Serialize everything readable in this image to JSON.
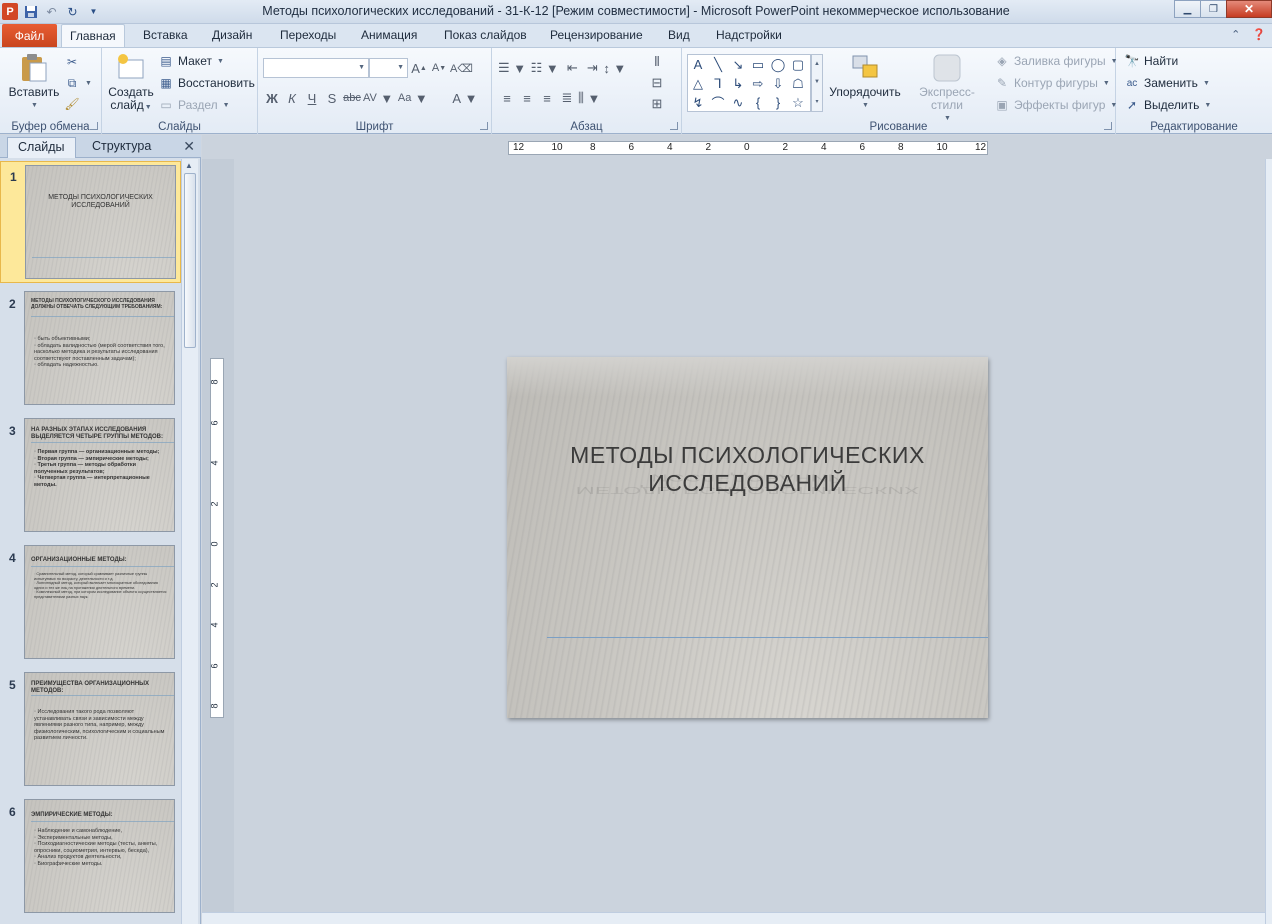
{
  "window": {
    "title": "Методы психологических исследований - 31-К-12 [Режим совместимости]  -  Microsoft PowerPoint некоммерческое использование"
  },
  "ribbon_tabs": {
    "file": "Файл",
    "tabs": [
      "Главная",
      "Вставка",
      "Дизайн",
      "Переходы",
      "Анимация",
      "Показ слайдов",
      "Рецензирование",
      "Вид",
      "Надстройки"
    ]
  },
  "clipboard": {
    "paste": "Вставить",
    "label": "Буфер обмена"
  },
  "slides_group": {
    "new_slide": "Создать",
    "new_slide_2": "слайд",
    "layout": "Макет",
    "reset": "Восстановить",
    "section": "Раздел",
    "label": "Слайды"
  },
  "font_group": {
    "label": "Шрифт"
  },
  "paragraph_group": {
    "label": "Абзац"
  },
  "drawing": {
    "arrange": "Упорядочить",
    "quick_styles": "Экспресс-стили",
    "fill": "Заливка фигуры",
    "outline": "Контур фигуры",
    "effects": "Эффекты фигур",
    "label": "Рисование"
  },
  "editing": {
    "find": "Найти",
    "replace": "Заменить",
    "select": "Выделить",
    "label": "Редактирование"
  },
  "panel": {
    "tab_slides": "Слайды",
    "tab_outline": "Структура"
  },
  "thumbnails": [
    {
      "num": "1",
      "title": "МЕТОДЫ ПСИХОЛОГИЧЕСКИХ ИССЛЕДОВАНИЙ"
    },
    {
      "num": "2",
      "title": "МЕТОДЫ ПСИХОЛОГИЧЕСКОГО ИССЛЕДОВАНИЯ ДОЛЖНЫ ОТВЕЧАТЬ СЛЕДУЮЩИМ ТРЕБОВАНИЯМ:",
      "bullets": [
        "быть объективными;",
        "обладать валидностью (мерой соответствия того, насколько методика и результаты исследования соответствуют поставленным задачам);",
        "обладать надежностью."
      ]
    },
    {
      "num": "3",
      "title": "НА РАЗНЫХ ЭТАПАХ ИССЛЕДОВАНИЯ ВЫДЕЛЯЕТСЯ ЧЕТЫРЕ ГРУППЫ МЕТОДОВ:",
      "bullets": [
        "Первая группа — организационные методы;",
        "Вторая группа — эмпирические методы;",
        "Третья группа — методы обработки полученных результатов;",
        "Четвертая группа — интерпретационные методы."
      ]
    },
    {
      "num": "4",
      "title": "ОРГАНИЗАЦИОННЫЕ МЕТОДЫ:",
      "bullets": [
        "Сравнительный метод, который сравнивает различные группы испытуемых по возрасту, деятельности и т.д.",
        "Лонгитюдный метод, который включает многократные обследования одних и тех же лиц на протяжении длительного времени.",
        "Комплексный метод, при котором исследование объекта осуществляется представителями разных наук."
      ]
    },
    {
      "num": "5",
      "title": "ПРЕИМУЩЕСТВА ОРГАНИЗАЦИОННЫХ МЕТОДОВ:",
      "bullets": [
        "Исследования такого рода позволяют устанавливать связи и зависимости между явлениями разного типа, например, между физиологическим, психологическим и социальным развитием личности."
      ]
    },
    {
      "num": "6",
      "title": "ЭМПИРИЧЕСКИЕ МЕТОДЫ:",
      "bullets": [
        "Наблюдение и самонаблюдение,",
        "Экспериментальные методы,",
        "Психодиагностические методы (тесты, анкеты, опросники, социометрия, интервью, беседа),",
        "Анализ продуктов деятельности,",
        "Биографические методы."
      ]
    }
  ],
  "slide": {
    "title_line1": "МЕТОДЫ ПСИХОЛОГИЧЕСКИХ",
    "title_line2": "ИССЛЕДОВАНИЙ"
  },
  "ruler_h": [
    "12",
    "10",
    "8",
    "6",
    "4",
    "2",
    "0",
    "2",
    "4",
    "6",
    "8",
    "10",
    "12"
  ],
  "ruler_v": [
    "8",
    "6",
    "4",
    "2",
    "0",
    "2",
    "4",
    "6",
    "8"
  ]
}
